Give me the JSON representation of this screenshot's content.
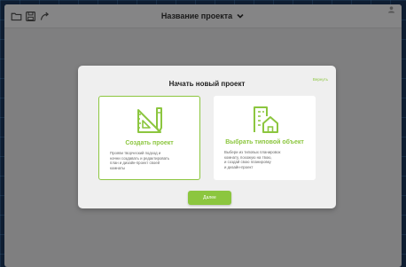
{
  "header": {
    "project_title": "Название проекта"
  },
  "toolbar_icons": [
    "folder-icon",
    "save-icon",
    "share-icon"
  ],
  "modal": {
    "title": "Начать новый проект",
    "back_link": "Вернуть",
    "cards": [
      {
        "icon": "drafting-tools-icon",
        "title": "Создать проект",
        "description": "Прояви творческий подход и\nначни создавать и редактировать\nплан и дизайн-проект своей\nкомнаты",
        "selected": true
      },
      {
        "icon": "house-building-icon",
        "title": "Выбрать типовой объект",
        "description": "Выбери из типовых планировок\nкомнату, похожую на твою,\nи создай свою планировку\nи дизайн-проект",
        "selected": false
      }
    ],
    "next_button": "Далее"
  },
  "colors": {
    "accent": "#8cc63f",
    "overlay": "#7f7f80",
    "modal_bg": "#efefef"
  }
}
